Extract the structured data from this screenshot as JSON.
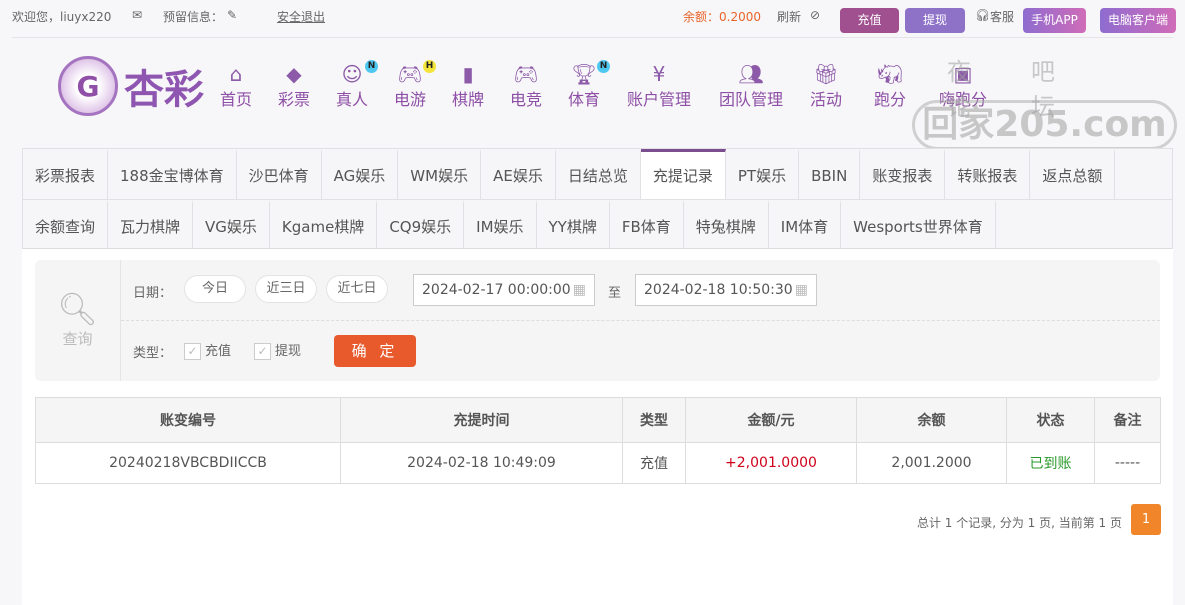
{
  "topbar": {
    "welcome": "欢迎您，liuyx220",
    "reserved_info": "预留信息：",
    "logout": "安全退出",
    "balance": "余额：0.2000",
    "refresh": "刷新",
    "recharge": "充值",
    "withdraw": "提现",
    "service": "客服",
    "mobile_app": "手机APP",
    "pc_client": "电脑客户端"
  },
  "logo": {
    "text": "杏彩"
  },
  "nav": [
    {
      "label": "首页",
      "icon": "home-icon"
    },
    {
      "label": "彩票",
      "icon": "ticket-icon"
    },
    {
      "label": "真人",
      "icon": "live-dealer-icon",
      "badge": "N"
    },
    {
      "label": "电游",
      "icon": "gamepad-icon",
      "badge": "H"
    },
    {
      "label": "棋牌",
      "icon": "cards-icon"
    },
    {
      "label": "电竞",
      "icon": "gamepad-icon"
    },
    {
      "label": "体育",
      "icon": "trophy-icon",
      "badge": "N"
    },
    {
      "label": "账户管理",
      "icon": "yen-icon"
    },
    {
      "label": "团队管理",
      "icon": "team-icon"
    },
    {
      "label": "活动",
      "icon": "gift-icon"
    },
    {
      "label": "跑分",
      "icon": "rhino-icon"
    },
    {
      "label": "嗨跑分",
      "icon": "app-icon"
    }
  ],
  "watermark": {
    "line1": "夜吧论坛",
    "line2": "回家205.com"
  },
  "tabs_row1": [
    "彩票报表",
    "188金宝博体育",
    "沙巴体育",
    "AG娱乐",
    "WM娱乐",
    "AE娱乐",
    "日结总览",
    "充提记录",
    "PT娱乐",
    "BBIN",
    "账变报表",
    "转账报表",
    "返点总额"
  ],
  "tabs_row2": [
    "余额查询",
    "瓦力棋牌",
    "VG娱乐",
    "Kgame棋牌",
    "CQ9娱乐",
    "IM娱乐",
    "YY棋牌",
    "FB体育",
    "特兔棋牌",
    "IM体育",
    "Wesports世界体育"
  ],
  "active_tab": "充提记录",
  "query": {
    "title": "查询",
    "date_label": "日期：",
    "today": "今日",
    "three_days": "近三日",
    "seven_days": "近七日",
    "start": "2024-02-17 00:00:00",
    "to": "至",
    "end": "2024-02-18 10:50:30",
    "type_label": "类型：",
    "type_recharge": "充值",
    "type_withdraw": "提现",
    "confirm": "确 定"
  },
  "table": {
    "headers": [
      "账变编号",
      "充提时间",
      "类型",
      "金额/元",
      "余额",
      "状态",
      "备注"
    ],
    "rows": [
      [
        "20240218VBCBDIICCB",
        "2024-02-18 10:49:09",
        "充值",
        "+2,001.0000",
        "2,001.2000",
        "已到账",
        "-----"
      ]
    ]
  },
  "pagination": {
    "summary": "总计 1 个记录, 分为 1 页, 当前第 1 页",
    "current": "1"
  },
  "colors": {
    "brand": "#8e56b0",
    "recharge_btn": "#a0508f",
    "withdraw_btn": "#8e72c8",
    "confirm": "#e8592b",
    "amount": "#d0021b",
    "status_ok": "#2a9a2a",
    "page_active": "#f0852a"
  }
}
